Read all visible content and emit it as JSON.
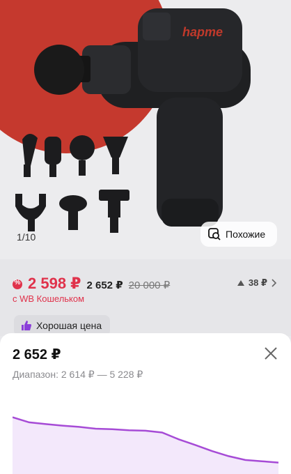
{
  "gallery": {
    "counter": "1/10",
    "brand_logo": "hapme",
    "similar_label": "Похожие"
  },
  "price": {
    "wallet_price": "2 598 ₽",
    "regular_price": "2 652 ₽",
    "old_price": "20 000 ₽",
    "wallet_note": "с WB Кошельком",
    "rating_text": "38 ₽",
    "good_price_label": "Хорошая цена"
  },
  "sheet": {
    "current_price": "2 652 ₽",
    "range_text": "Диапазон: 2 614 ₽ — 5 228 ₽"
  },
  "colors": {
    "accent_red": "#e0324b",
    "chart_line": "#a64bd6",
    "chart_fill": "#f3e8fb"
  },
  "chart_data": {
    "type": "area",
    "values": [
      5228,
      5030,
      4960,
      4900,
      4850,
      4780,
      4760,
      4720,
      4700,
      4630,
      4360,
      4140,
      3900,
      3700,
      3550,
      3500,
      3450
    ],
    "title": "",
    "xlabel": "",
    "ylabel": ""
  }
}
